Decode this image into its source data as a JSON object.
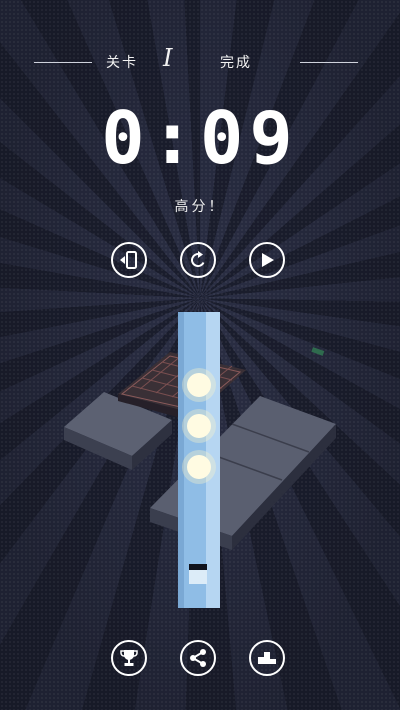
{
  "header": {
    "level_label": "关卡",
    "level_number": "I",
    "status": "完成"
  },
  "result": {
    "time": "0:09",
    "message": "高分！"
  },
  "controls": {
    "top": [
      "exit-door-icon",
      "restart-icon",
      "play-icon"
    ],
    "bottom": [
      "trophy-icon",
      "share-icon",
      "podium-icon"
    ]
  },
  "colors": {
    "background": "#1f2233",
    "light_beam": "#8fbde6",
    "orb": "#fffbe2",
    "platform": "#5a5f70"
  }
}
